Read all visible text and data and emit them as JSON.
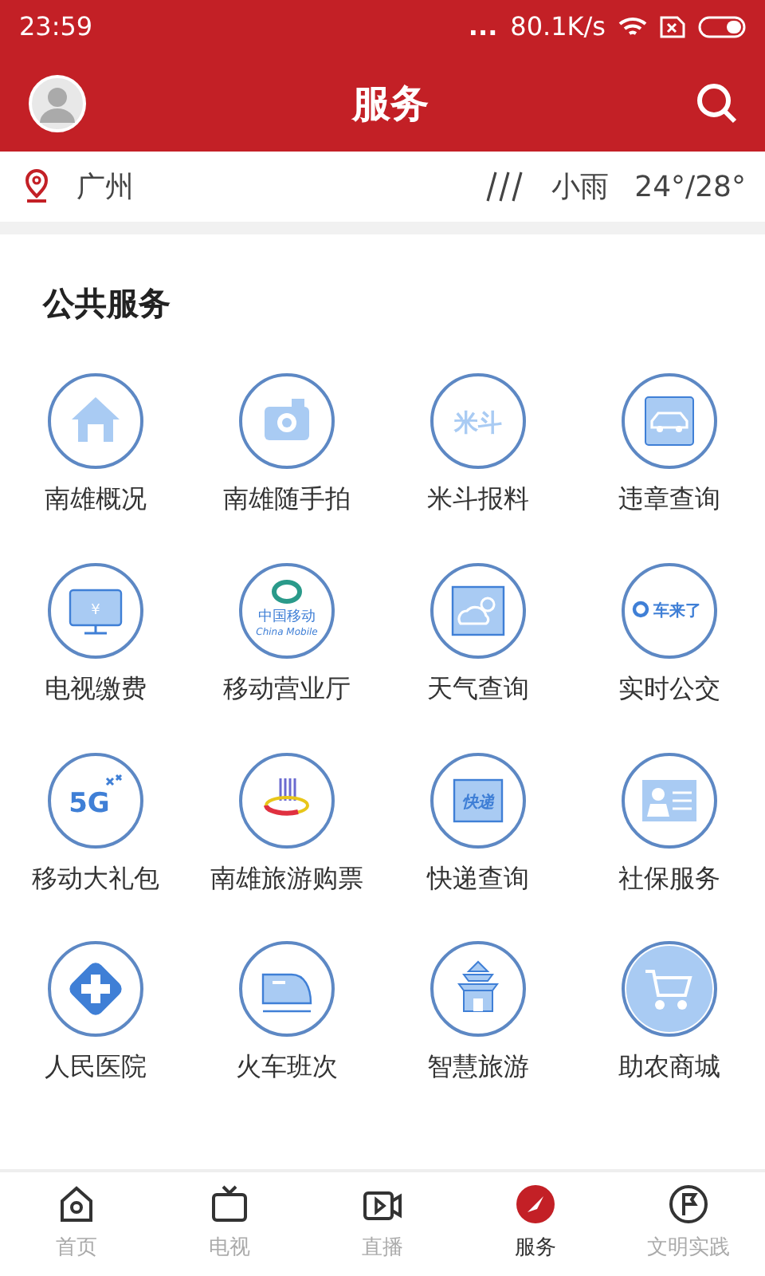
{
  "status_bar": {
    "time": "23:59",
    "dots": "...",
    "speed": "80.1K/s"
  },
  "header": {
    "title": "服务"
  },
  "weather": {
    "city": "广州",
    "condition": "小雨",
    "temperature": "24°/28°"
  },
  "section": {
    "title": "公共服务",
    "items": [
      {
        "label": "南雄概况",
        "kind": "house"
      },
      {
        "label": "南雄随手拍",
        "kind": "camera"
      },
      {
        "label": "米斗报料",
        "kind": "textlogo",
        "icon_text": "米斗"
      },
      {
        "label": "违章查询",
        "kind": "car"
      },
      {
        "label": "电视缴费",
        "kind": "tv",
        "icon_text": "¥"
      },
      {
        "label": "移动营业厅",
        "kind": "mobile",
        "icon_text": "中国移动",
        "icon_subtext": "China Mobile"
      },
      {
        "label": "天气查询",
        "kind": "weather"
      },
      {
        "label": "实时公交",
        "kind": "bus",
        "icon_text": "车来了"
      },
      {
        "label": "移动大礼包",
        "kind": "fiveg",
        "icon_text": "5G"
      },
      {
        "label": "南雄旅游购票",
        "kind": "tour"
      },
      {
        "label": "快递查询",
        "kind": "textbox",
        "icon_text": "快递"
      },
      {
        "label": "社保服务",
        "kind": "idcard"
      },
      {
        "label": "人民医院",
        "kind": "hospital"
      },
      {
        "label": "火车班次",
        "kind": "train"
      },
      {
        "label": "智慧旅游",
        "kind": "temple"
      },
      {
        "label": "助农商城",
        "kind": "cart"
      }
    ]
  },
  "tab_bar": [
    {
      "label": "首页",
      "kind": "home",
      "selected": false
    },
    {
      "label": "电视",
      "kind": "tv",
      "selected": false
    },
    {
      "label": "直播",
      "kind": "video",
      "selected": false
    },
    {
      "label": "服务",
      "kind": "compass",
      "selected": true
    },
    {
      "label": "文明实践",
      "kind": "flag",
      "selected": false
    }
  ]
}
